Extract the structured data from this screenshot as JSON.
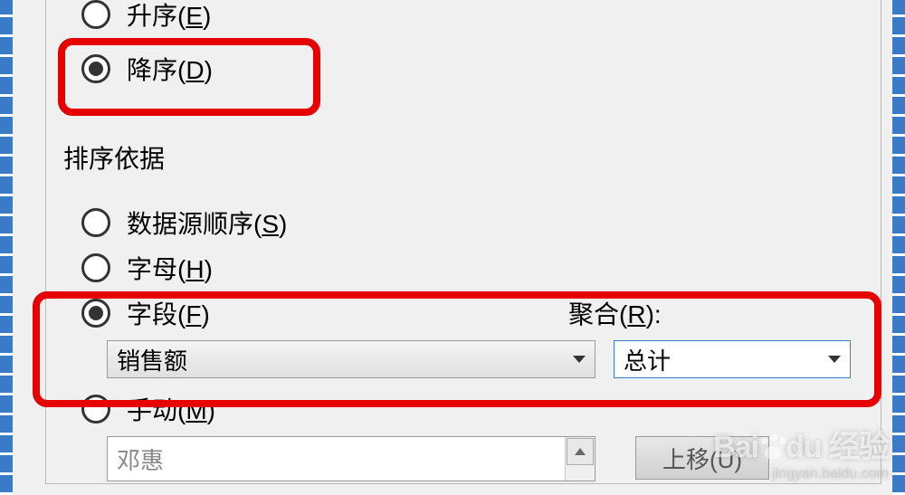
{
  "sortOrder": {
    "ascending": {
      "label": "升序(",
      "key": "E",
      "suffix": ")"
    },
    "descending": {
      "label": "降序(",
      "key": "D",
      "suffix": ")"
    }
  },
  "sortBy": {
    "sectionTitle": "排序依据",
    "dataSourceOrder": {
      "label": "数据源顺序(",
      "key": "S",
      "suffix": ")"
    },
    "alphabet": {
      "label": "字母(",
      "key": "H",
      "suffix": ")"
    },
    "field": {
      "label": "字段(",
      "key": "F",
      "suffix": ")"
    },
    "manual": {
      "label": "手动(",
      "key": "M",
      "suffix": ")"
    }
  },
  "aggregation": {
    "label": "聚合(",
    "key": "R",
    "suffix": "):"
  },
  "dropdowns": {
    "fieldValue": "销售额",
    "aggregationValue": "总计"
  },
  "listbox": {
    "item": "邓惠"
  },
  "buttons": {
    "moveUp": "上移(U)"
  },
  "watermark": {
    "logo1": "Bai",
    "logo2": "du",
    "logo3": "经验",
    "sub": "jingyan.baidu.com"
  }
}
